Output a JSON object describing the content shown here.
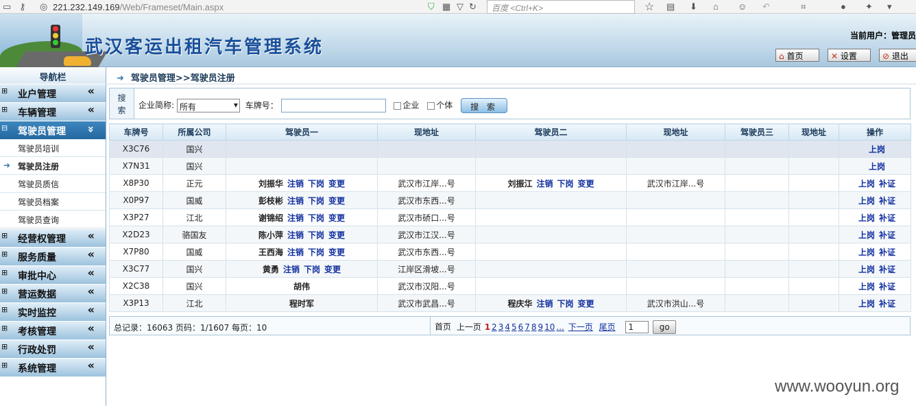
{
  "browser": {
    "url_host": "221.232.149.169",
    "url_path": "/Web/Frameset/Main.aspx",
    "search_placeholder": "百度 <Ctrl+K>"
  },
  "header": {
    "title": "武汉客运出租汽车管理系统",
    "current_user": "当前用户：管理员",
    "btn_home": "首页",
    "btn_settings": "设置",
    "btn_logout": "退出"
  },
  "nav": {
    "title": "导航栏",
    "groups": [
      {
        "label": "业户管理",
        "chev": "«"
      },
      {
        "label": "车辆管理",
        "chev": "«"
      },
      {
        "label": "驾驶员管理",
        "chev": "»"
      },
      {
        "label": "经营权管理",
        "chev": "«"
      },
      {
        "label": "服务质量",
        "chev": "«"
      },
      {
        "label": "审批中心",
        "chev": "«"
      },
      {
        "label": "营运数据",
        "chev": "«"
      },
      {
        "label": "实时监控",
        "chev": "«"
      },
      {
        "label": "考核管理",
        "chev": "«"
      },
      {
        "label": "行政处罚",
        "chev": "«"
      },
      {
        "label": "系统管理",
        "chev": "«"
      }
    ],
    "subs": [
      "驾驶员培训",
      "驾驶员注册",
      "驾驶员质信",
      "驾驶员档案",
      "驾驶员查询"
    ]
  },
  "breadcrumb": "驾驶员管理>>驾驶员注册",
  "search": {
    "label": "搜索",
    "company_label": "企业简称:",
    "company_value": "所有",
    "plate_label": "车牌号：",
    "cb_company": "企业",
    "cb_individual": "个体",
    "button": "搜 索"
  },
  "table": {
    "headers": [
      "车牌号",
      "所属公司",
      "驾驶员一",
      "现地址",
      "驾驶员二",
      "现地址",
      "驾驶员三",
      "现地址",
      "操作"
    ],
    "rows": [
      {
        "plate": "X3C76",
        "company": "国兴",
        "d1": "",
        "a1": "",
        "d2": "",
        "a2": "",
        "d3": "",
        "a3": "",
        "op1": "上岗",
        "op2": ""
      },
      {
        "plate": "X7N31",
        "company": "国兴",
        "d1": "",
        "a1": "",
        "d2": "",
        "a2": "",
        "d3": "",
        "a3": "",
        "op1": "上岗",
        "op2": ""
      },
      {
        "plate": "X8P30",
        "company": "正元",
        "d1": "刘振华",
        "a1": "武汉市江岸...号",
        "d2": "刘振江",
        "a2": "武汉市江岸...号",
        "d3": "",
        "a3": "",
        "op1": "上岗",
        "op2": "补证"
      },
      {
        "plate": "X0P97",
        "company": "国威",
        "d1": "彭枝彬",
        "a1": "武汉市东西...号",
        "d2": "",
        "a2": "",
        "d3": "",
        "a3": "",
        "op1": "上岗",
        "op2": "补证"
      },
      {
        "plate": "X3P27",
        "company": "江北",
        "d1": "谢锦绍",
        "a1": "武汉市硚口...号",
        "d2": "",
        "a2": "",
        "d3": "",
        "a3": "",
        "op1": "上岗",
        "op2": "补证"
      },
      {
        "plate": "X2D23",
        "company": "骆国友",
        "d1": "陈小萍",
        "a1": "武汉市江汉...号",
        "d2": "",
        "a2": "",
        "d3": "",
        "a3": "",
        "op1": "上岗",
        "op2": "补证"
      },
      {
        "plate": "X7P80",
        "company": "国威",
        "d1": "王西海",
        "a1": "武汉市东西...号",
        "d2": "",
        "a2": "",
        "d3": "",
        "a3": "",
        "op1": "上岗",
        "op2": "补证"
      },
      {
        "plate": "X3C77",
        "company": "国兴",
        "d1": "黄勇",
        "a1": "江岸区滑坡...号",
        "d2": "",
        "a2": "",
        "d3": "",
        "a3": "",
        "op1": "上岗",
        "op2": "补证"
      },
      {
        "plate": "X2C38",
        "company": "国兴",
        "d1": "胡伟",
        "a1": "武汉市汉阳...号",
        "d2": "",
        "a2": "",
        "d3": "",
        "a3": "",
        "op1": "上岗",
        "op2": "补证"
      },
      {
        "plate": "X3P13",
        "company": "江北",
        "d1": "程时军",
        "a1": "武汉市武昌...号",
        "d2": "程庆华",
        "a2": "武汉市洪山...号",
        "d3": "",
        "a3": "",
        "op1": "上岗",
        "op2": "补证"
      }
    ],
    "act_cancel": "注销",
    "act_off": "下岗",
    "act_change": "变更"
  },
  "pager": {
    "summary": "总记录：16063 页码：1/1607 每页：10",
    "first": "首页",
    "prev": "上一页",
    "pages": [
      "1",
      "2",
      "3",
      "4",
      "5",
      "6",
      "7",
      "8",
      "9",
      "10",
      "..."
    ],
    "next": "下一页",
    "last": "尾页",
    "page_input": "1",
    "go": "go"
  },
  "watermark": "www.wooyun.org"
}
